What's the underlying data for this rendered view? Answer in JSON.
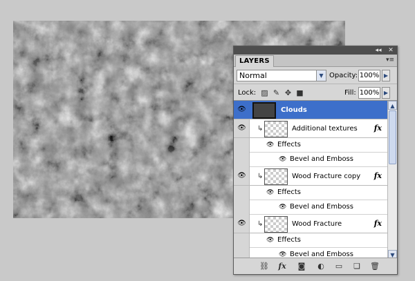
{
  "panel": {
    "title_buttons": {
      "collapse": "◂◂",
      "close": "✕"
    },
    "tab_label": "LAYERS",
    "menu_icon": "panel-menu-icon",
    "blend_mode": "Normal",
    "opacity_label": "Opacity:",
    "opacity_value": "100%",
    "lock_label": "Lock:",
    "fill_label": "Fill:",
    "fill_value": "100%",
    "lock_icons": [
      "lock-transparent-icon",
      "lock-image-icon",
      "lock-position-icon",
      "lock-all-icon"
    ],
    "layers": [
      {
        "name": "Clouds",
        "selected": true,
        "fx": false
      },
      {
        "name": "Additional textures",
        "selected": false,
        "fx": true,
        "effects_label": "Effects",
        "effect": "Bevel and Emboss"
      },
      {
        "name": "Wood Fracture copy",
        "selected": false,
        "fx": true,
        "effects_label": "Effects",
        "effect": "Bevel and Emboss"
      },
      {
        "name": "Wood Fracture",
        "selected": false,
        "fx": true,
        "effects_label": "Effects",
        "effect": "Bevel and Emboss"
      }
    ],
    "fx_symbol": "fx",
    "bottom_icons": [
      "link-layers-icon",
      "add-style-icon",
      "add-mask-icon",
      "adjustment-layer-icon",
      "new-group-icon",
      "new-layer-icon",
      "delete-layer-icon"
    ],
    "bottom_icon_glyphs": [
      "⛓",
      "fx",
      "◙",
      "◐",
      "▭",
      "❏",
      "🗑"
    ]
  },
  "colors": {
    "selected_row": "#3d6fca",
    "panel_bg": "#d6d6d6",
    "workspace_bg": "#c9c9c9"
  }
}
